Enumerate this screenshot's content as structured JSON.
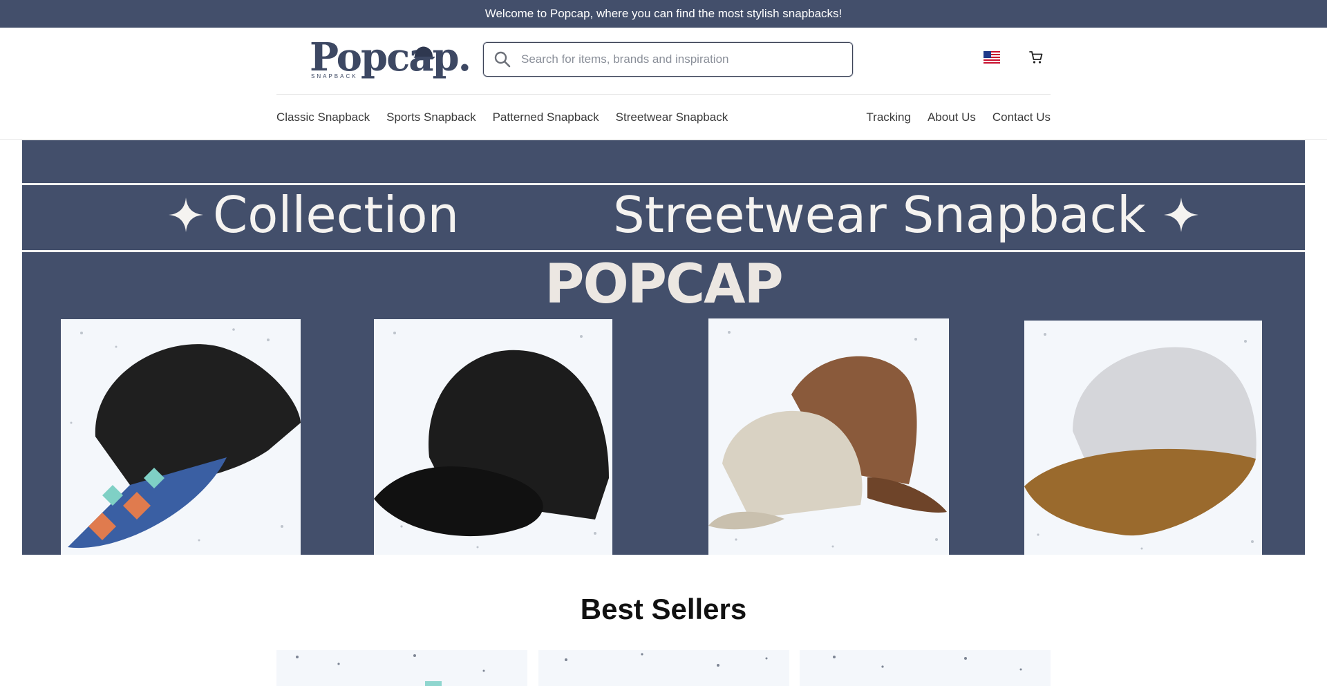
{
  "announcement": "Welcome to Popcap, where you can find the most stylish snapbacks!",
  "logo": {
    "word": "Popcap.",
    "sub": "SNAPBACK"
  },
  "search": {
    "placeholder": "Search for items, brands and inspiration",
    "icon": "search-icon"
  },
  "header_icons": {
    "flag": "us-flag-icon",
    "cart": "cart-icon"
  },
  "nav": {
    "left": [
      "Classic Snapback",
      "Sports Snapback",
      "Patterned Snapback",
      "Streetwear Snapback"
    ],
    "right": [
      "Tracking",
      "About Us",
      "Contact Us"
    ]
  },
  "hero": {
    "title_left": "Collection",
    "title_right": "Streetwear Snapback",
    "brand": "POPCAP"
  },
  "section_title": "Best Sellers",
  "colors": {
    "brand_navy": "#434f6b",
    "cream": "#f5f3f0"
  }
}
